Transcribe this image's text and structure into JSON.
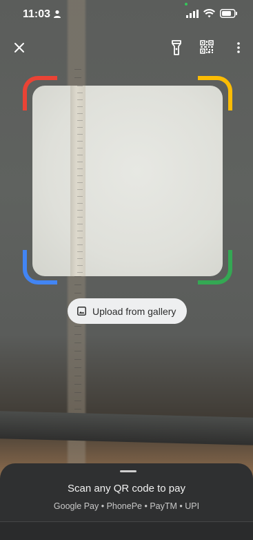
{
  "status_bar": {
    "time": "11:03"
  },
  "toolbar": {
    "close_icon": "close-icon",
    "flashlight_icon": "flashlight-icon",
    "my_qr_icon": "qr-code-icon",
    "more_icon": "more-vert-icon"
  },
  "scanner": {
    "corner_colors": [
      "#ea4335",
      "#fbbc04",
      "#4285f4",
      "#34a853"
    ]
  },
  "upload": {
    "label": "Upload from gallery",
    "icon": "image-icon"
  },
  "bottom_sheet": {
    "title": "Scan any QR code to pay",
    "subtitle": "Google Pay • PhonePe • PayTM • UPI"
  }
}
